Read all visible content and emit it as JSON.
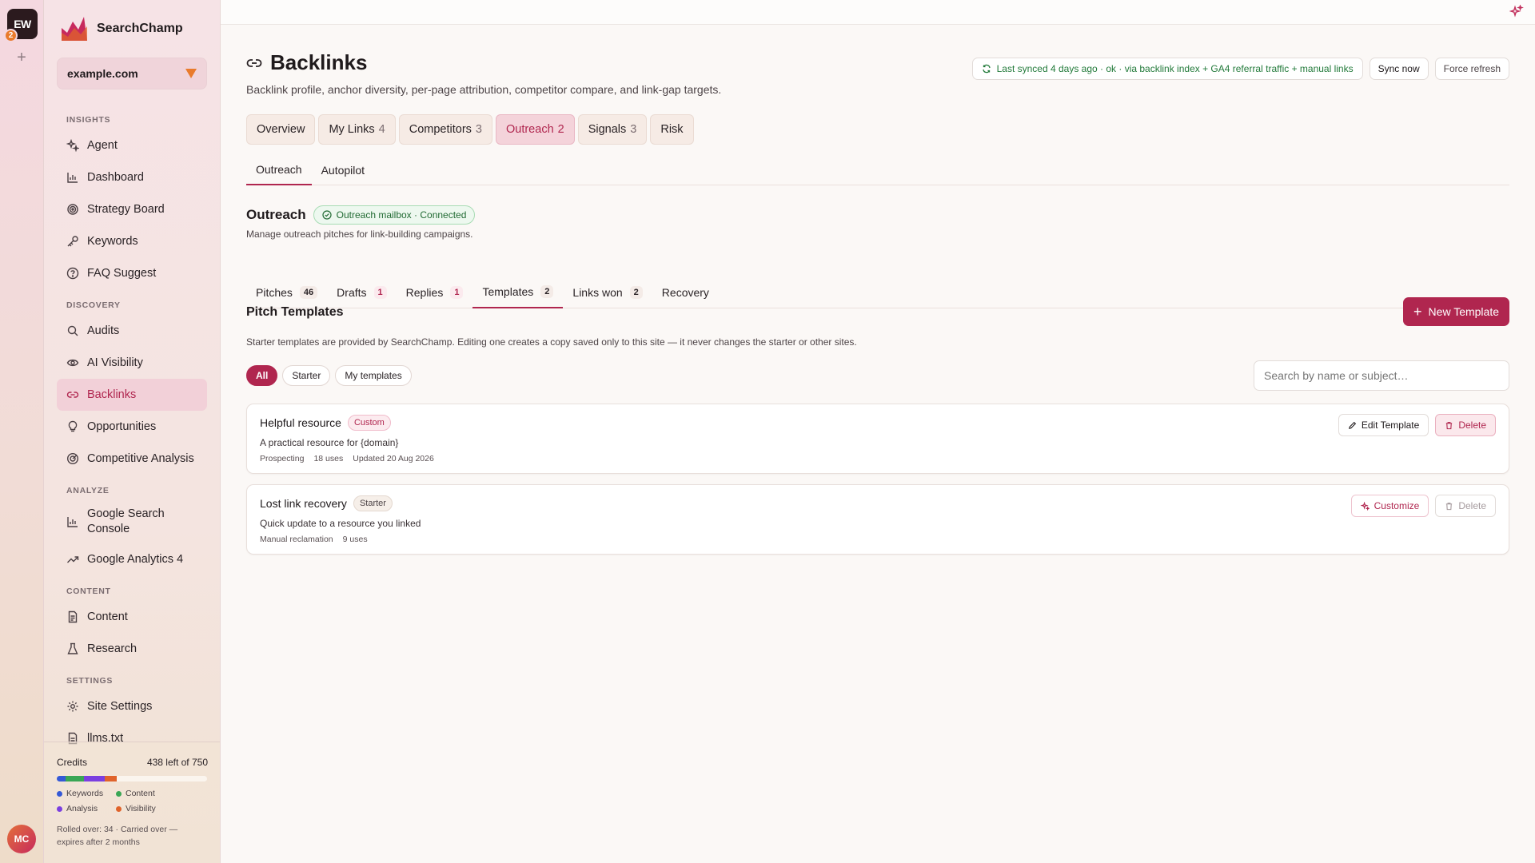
{
  "workspace": {
    "initials": "EW",
    "badge_count": "2",
    "add_symbol": "+"
  },
  "user": {
    "initials": "MC"
  },
  "brand": {
    "name": "SearchChamp"
  },
  "site": {
    "name": "example.com"
  },
  "nav": {
    "sections": [
      {
        "title": "INSIGHTS",
        "items": [
          "Agent",
          "Dashboard",
          "Strategy Board",
          "Keywords",
          "FAQ Suggest"
        ]
      },
      {
        "title": "DISCOVERY",
        "items": [
          "Audits",
          "AI Visibility",
          "Backlinks",
          "Opportunities",
          "Competitive Analysis"
        ]
      },
      {
        "title": "ANALYZE",
        "items": [
          "Google Search Console",
          "Google Analytics 4"
        ]
      },
      {
        "title": "CONTENT",
        "items": [
          "Content",
          "Research"
        ]
      },
      {
        "title": "SETTINGS",
        "items": [
          "Site Settings",
          "llms.txt"
        ]
      }
    ],
    "active": "Backlinks"
  },
  "credits": {
    "label": "Credits",
    "remaining": "438 left of 750",
    "usage_fractions": {
      "keywords": 0.06,
      "content": 0.12,
      "analysis": 0.14,
      "visibility": 0.08
    },
    "legend": [
      "Keywords",
      "Content",
      "Analysis",
      "Visibility"
    ],
    "colors": {
      "keywords": "#3559d6",
      "content": "#3aa655",
      "analysis": "#7b3fe0",
      "visibility": "#e0632b"
    },
    "rollover": "Rolled over: 34 · Carried over — expires after 2 months"
  },
  "page": {
    "title": "Backlinks",
    "subtitle": "Backlink profile, anchor diversity, per-page attribution, competitor compare, and link-gap targets.",
    "sync_status": "Last synced 4 days ago · ok · via backlink index + GA4 referral traffic + manual links",
    "sync_now": "Sync now",
    "force_refresh": "Force refresh"
  },
  "main_tabs": [
    {
      "label": "Overview",
      "count": ""
    },
    {
      "label": "My Links",
      "count": "4"
    },
    {
      "label": "Competitors",
      "count": "3"
    },
    {
      "label": "Outreach",
      "count": "2"
    },
    {
      "label": "Signals",
      "count": "3"
    },
    {
      "label": "Risk",
      "count": ""
    }
  ],
  "sub_tabs": [
    "Outreach",
    "Autopilot"
  ],
  "outreach": {
    "title": "Outreach",
    "mailbox": "Outreach mailbox · Connected",
    "subtitle": "Manage outreach pitches for link-building campaigns."
  },
  "status_tabs": [
    {
      "label": "Pitches",
      "count": "46"
    },
    {
      "label": "Drafts",
      "count": "1"
    },
    {
      "label": "Replies",
      "count": "1"
    },
    {
      "label": "Templates",
      "count": "2"
    },
    {
      "label": "Links won",
      "count": "2"
    },
    {
      "label": "Recovery",
      "count": ""
    }
  ],
  "templates": {
    "title": "Pitch Templates",
    "new_button": "New Template",
    "note": "Starter templates are provided by SearchChamp. Editing one creates a copy saved only to this site — it never changes the starter or other sites.",
    "filters": [
      "All",
      "Starter",
      "My templates"
    ],
    "search_placeholder": "Search by name or subject…",
    "items": [
      {
        "name": "Helpful resource",
        "tag": "Custom",
        "description": "A practical resource for {domain}",
        "meta": [
          "Prospecting",
          "18 uses",
          "Updated 20 Aug 2026"
        ],
        "primary_action": "Edit Template",
        "delete": "Delete"
      },
      {
        "name": "Lost link recovery",
        "tag": "Starter",
        "description": "Quick update to a resource you linked",
        "meta": [
          "Manual reclamation",
          "9 uses"
        ],
        "primary_action": "Customize",
        "delete": "Delete"
      }
    ]
  },
  "colors": {
    "accent": "#b0264f",
    "success": "#227a3a"
  }
}
